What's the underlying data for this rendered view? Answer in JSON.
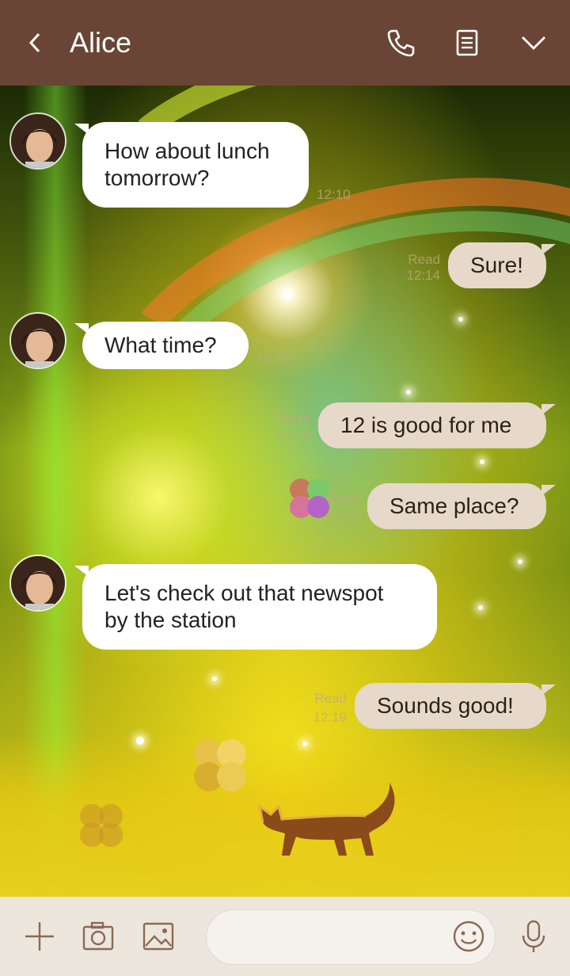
{
  "header": {
    "title": "Alice",
    "back_icon": "chevron-left-icon",
    "call_icon": "phone-icon",
    "notes_icon": "notes-icon",
    "menu_icon": "chevron-down-icon"
  },
  "messages": [
    {
      "direction": "in",
      "lines": [
        "How about lunch",
        "tomorrow?"
      ],
      "time": "12:10"
    },
    {
      "direction": "out",
      "lines": [
        "Sure!"
      ],
      "read": "Read",
      "time": "12:14"
    },
    {
      "direction": "in",
      "lines": [
        "What time?"
      ],
      "time": "12:14"
    },
    {
      "direction": "out",
      "lines": [
        "12 is good for me"
      ],
      "read": "Read",
      "time": "12:16"
    },
    {
      "direction": "out",
      "lines": [
        "Same place?"
      ],
      "read": "Read",
      "time": "12:16"
    },
    {
      "direction": "in",
      "lines": [
        "Let's check out that newspot",
        "by the station"
      ],
      "time": ""
    },
    {
      "direction": "out",
      "lines": [
        "Sounds good!"
      ],
      "read": "Read",
      "time": "12:19"
    }
  ],
  "bottom_bar": {
    "plus_icon": "plus-icon",
    "camera_icon": "camera-icon",
    "image_icon": "image-icon",
    "message_placeholder": "",
    "emoji_icon": "emoji-icon",
    "mic_icon": "microphone-icon"
  },
  "colors": {
    "header_bg": "#6a4535",
    "bubble_in": "#ffffff",
    "bubble_out": "#e6d9c9",
    "bottom_bg": "#ede6dd",
    "icon_color": "#8a6a57"
  }
}
